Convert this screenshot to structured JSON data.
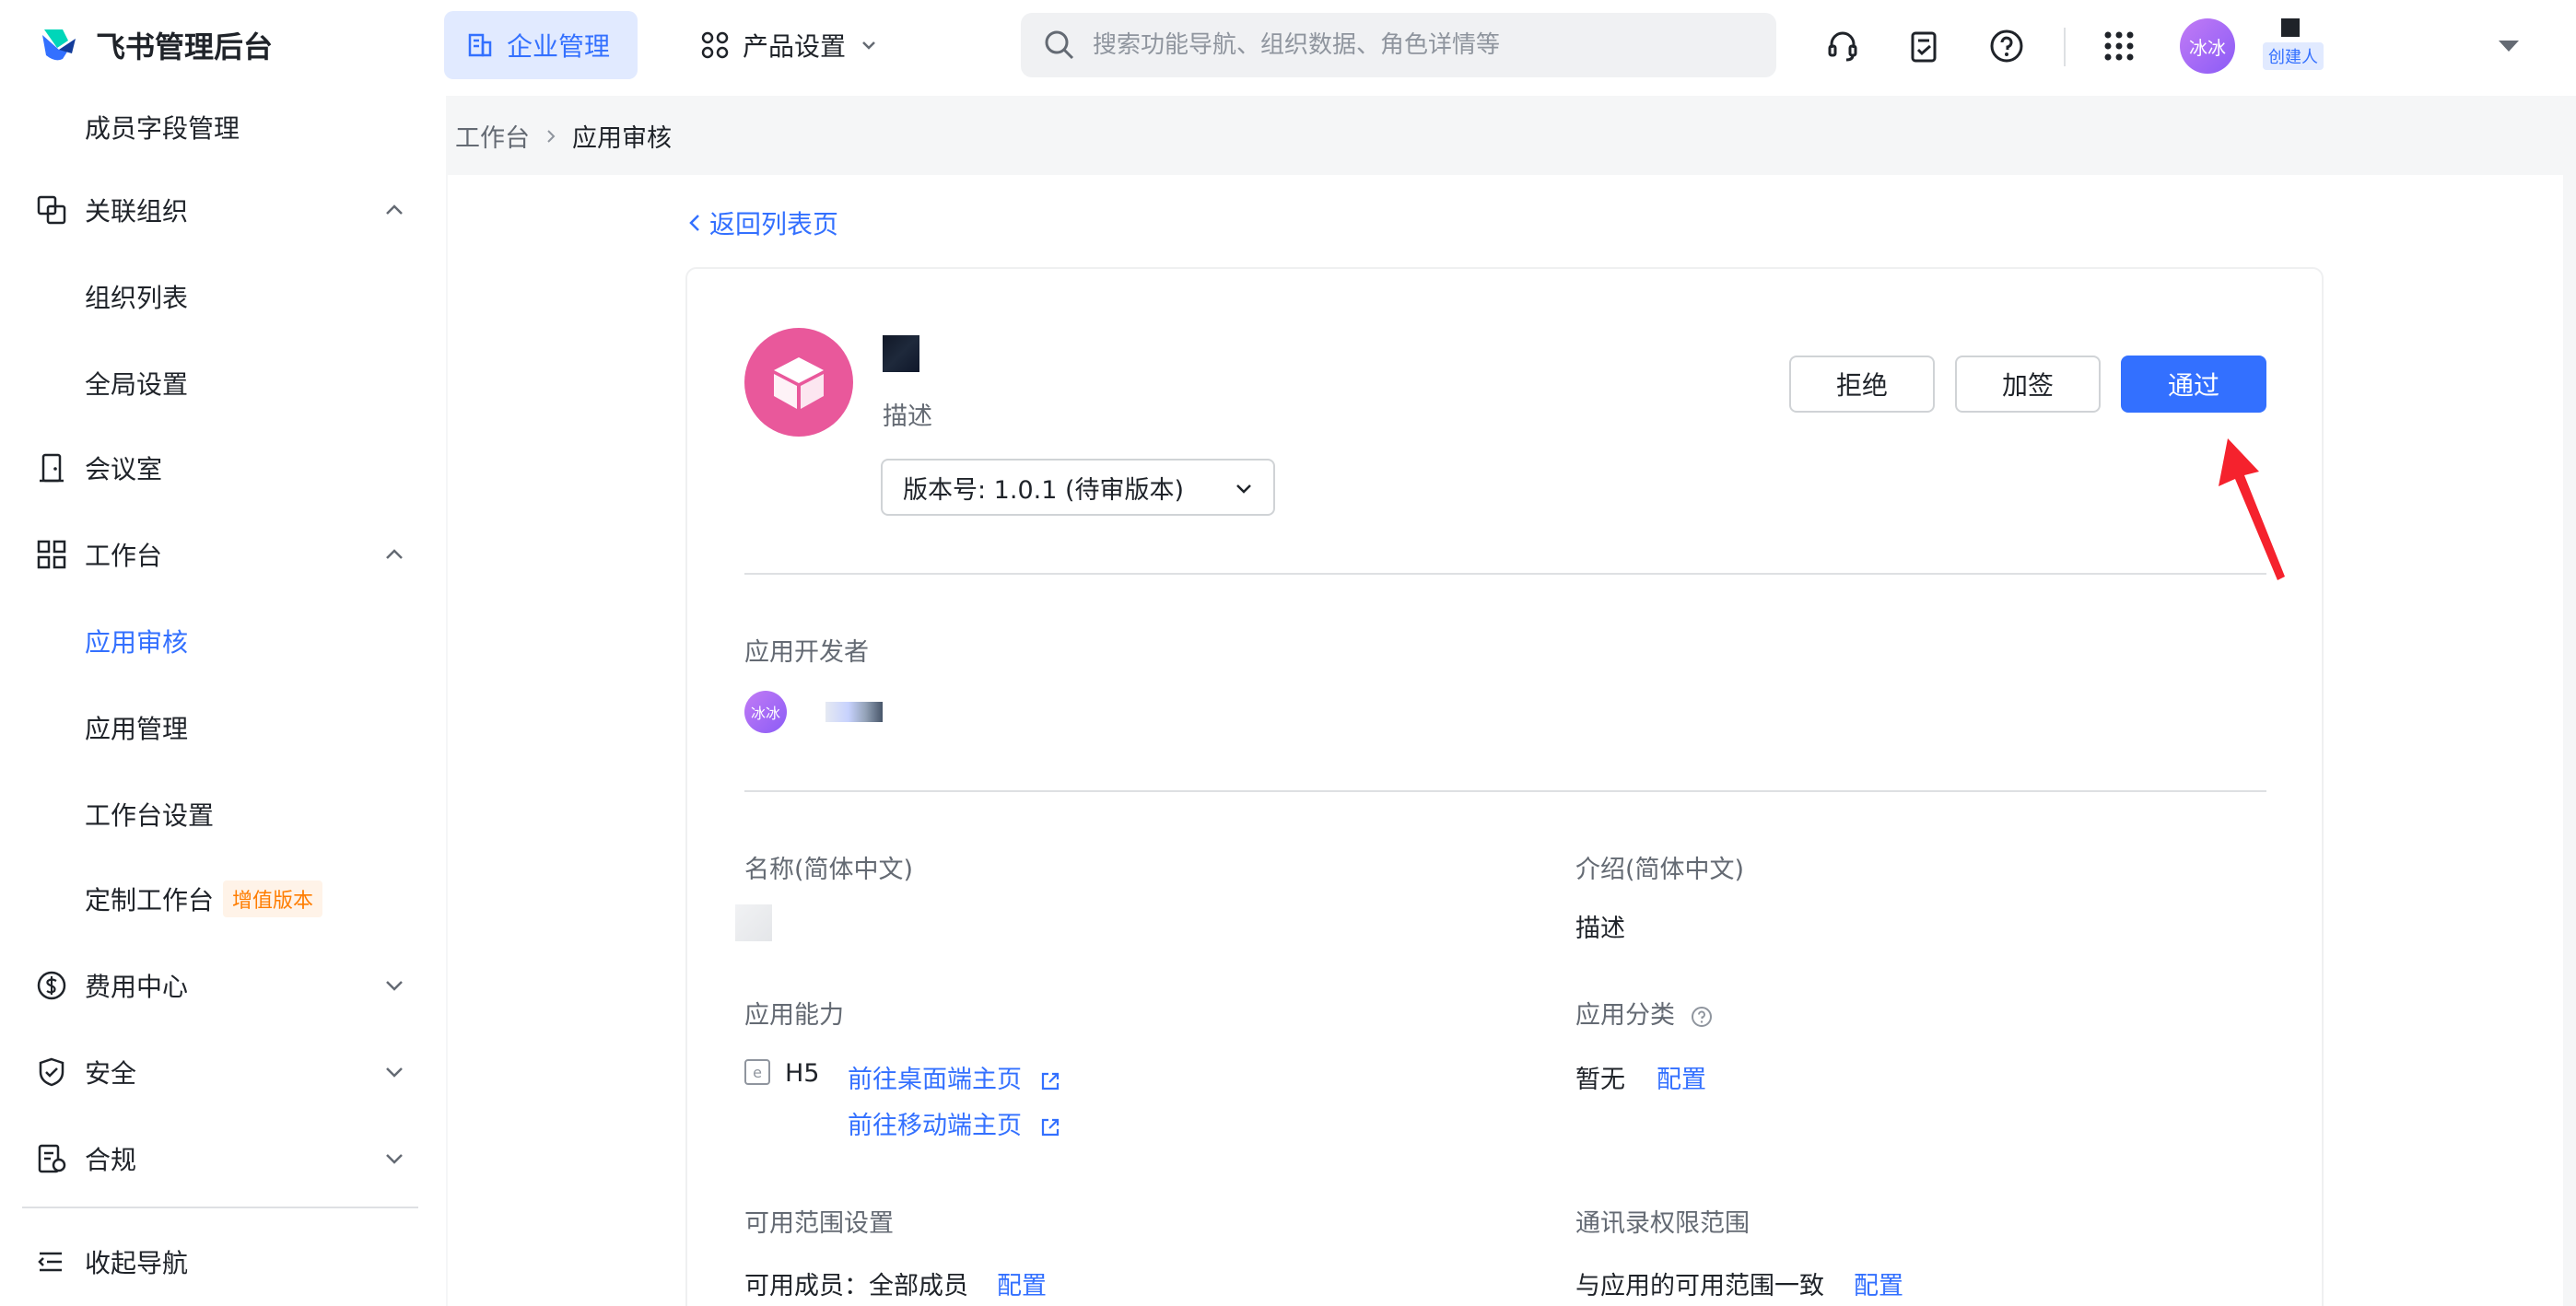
{
  "header": {
    "brand_title": "飞书管理后台",
    "nav_enterprise": "企业管理",
    "nav_product": "产品设置",
    "search_placeholder": "搜索功能导航、组织数据、角色详情等",
    "avatar_text": "冰冰",
    "creator_badge": "创建人"
  },
  "sidebar": {
    "items": [
      {
        "label": "成员字段管理"
      },
      {
        "label": "关联组织"
      },
      {
        "label": "组织列表"
      },
      {
        "label": "全局设置"
      },
      {
        "label": "会议室"
      },
      {
        "label": "工作台"
      },
      {
        "label": "应用审核"
      },
      {
        "label": "应用管理"
      },
      {
        "label": "工作台设置"
      },
      {
        "label": "定制工作台",
        "tag": "增值版本"
      },
      {
        "label": "费用中心"
      },
      {
        "label": "安全"
      },
      {
        "label": "合规"
      },
      {
        "label": "收起导航"
      }
    ]
  },
  "breadcrumb": {
    "parent": "工作台",
    "current": "应用审核"
  },
  "detail": {
    "back_link": "返回列表页",
    "app_desc": "描述",
    "version_label": "版本号: 1.0.1 (待审版本)",
    "buttons": {
      "reject": "拒绝",
      "countersign": "加签",
      "approve": "通过"
    },
    "developer_label": "应用开发者",
    "developer_avatar_text": "冰冰",
    "name_label": "名称(简体中文)",
    "intro_label": "介绍(简体中文)",
    "intro_value": "描述",
    "ability_label": "应用能力",
    "ability_type": "H5",
    "desktop_link": "前往桌面端主页",
    "mobile_link": "前往移动端主页",
    "category_label": "应用分类",
    "category_value": "暂无",
    "category_config": "配置",
    "scope_label": "可用范围设置",
    "scope_value": "可用成员：全部成员",
    "scope_config": "配置",
    "contacts_label": "通讯录权限范围",
    "contacts_value": "与应用的可用范围一致",
    "contacts_config": "配置"
  },
  "colors": {
    "accent": "#3370ff",
    "app_logo": "#e9589b",
    "arrow": "#f5222d",
    "tag_text": "#ff7d00"
  }
}
